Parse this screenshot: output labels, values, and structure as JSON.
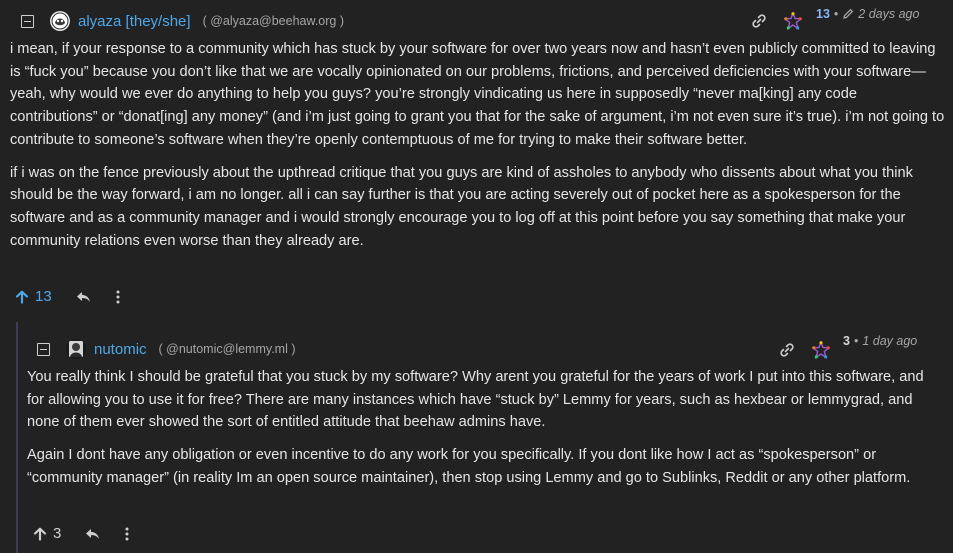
{
  "comments": [
    {
      "username": "alyaza [they/she]",
      "handle": "( @alyaza@beehaw.org )",
      "score": "13",
      "edited": true,
      "ago": "2 days ago",
      "paragraphs": [
        "i mean, if your response to a community which has stuck by your software for over two years now and hasn’t even publicly committed to leaving is “fuck you” because you don’t like that we are vocally opinionated on our problems, frictions, and perceived deficiencies with your software—yeah, why would we ever do anything to help you guys? you’re strongly vindicating us here in supposedly “never ma[king] any code contributions” or “donat[ing] any money” (and i’m just going to grant you that for the sake of argument, i’m not even sure it’s true). i’m not going to contribute to someone’s software when they’re openly contemptuous of me for trying to make their software better.",
        "if i was on the fence previously about the upthread critique that you guys are kind of assholes to anybody who dissents about what you think should be the way forward, i am no longer. all i can say further is that you are acting severely out of pocket here as a spokesperson for the software and as a community manager and i would strongly encourage you to log off at this point before you say something that make your community relations even worse than they already are."
      ],
      "votes": "13"
    },
    {
      "username": "nutomic",
      "handle": "( @nutomic@lemmy.ml )",
      "score": "3",
      "edited": false,
      "ago": "1 day ago",
      "paragraphs": [
        "You really think I should be grateful that you stuck by my software? Why arent you grateful for the years of work I put into this software, and for allowing you to use it for free? There are many instances which have “stuck by” Lemmy for years, such as hexbear or lemmygrad, and none of them ever showed the sort of entitled attitude that beehaw admins have.",
        "Again I dont have any obligation or even incentive to do any work for you specifically. If you dont like how I act as “spokesperson” or “community manager” (in reality Im an open source maintainer), then stop using Lemmy and go to Sublinks, Reddit or any other platform."
      ],
      "votes": "3"
    }
  ],
  "separator": "•",
  "icons": {
    "collapse": "collapse-minus-icon",
    "link": "link-icon",
    "fediverse": "fediverse-pentagram-icon",
    "edit": "pencil-icon",
    "upvote": "arrow-up-icon",
    "reply": "reply-arrow-icon",
    "more": "vertical-dots-icon"
  },
  "colors": {
    "background": "#222222",
    "username": "#4ea8e8",
    "score": "#8ab4f8",
    "upvoted": "#4ea8e8",
    "thread_line": "#3b3b55"
  }
}
